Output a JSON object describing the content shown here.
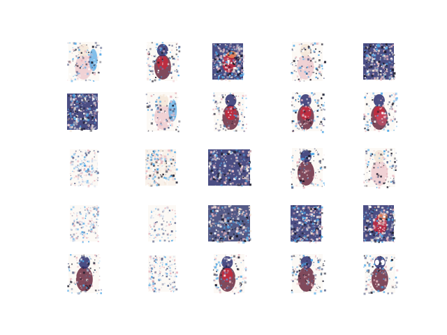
{
  "figure": {
    "rows": 5,
    "cols": 5,
    "background": "#ffffff",
    "palette": {
      "navy": "#2b2f6e",
      "maroon": "#6a2a3f",
      "crimson": "#c8283c",
      "pink": "#e8b7c0",
      "sky": "#4fa7e6",
      "cream": "#f3e6d7",
      "slate": "#5a6288",
      "ink": "#1a1a2a"
    },
    "tiles": [
      {
        "id": 1,
        "motif": "figure-left-blue-right"
      },
      {
        "id": 2,
        "motif": "red-figure-thin"
      },
      {
        "id": 3,
        "motif": "dark-block-red-center"
      },
      {
        "id": 4,
        "motif": "pale-figure"
      },
      {
        "id": 5,
        "motif": "dark-noisy-block"
      },
      {
        "id": 6,
        "motif": "dark-noisy-block"
      },
      {
        "id": 7,
        "motif": "faint-figure-blue-spots"
      },
      {
        "id": 8,
        "motif": "red-figure-crouched"
      },
      {
        "id": 9,
        "motif": "blurred-face"
      },
      {
        "id": 10,
        "motif": "blurred-face-pink"
      },
      {
        "id": 11,
        "motif": "blue-edge-noisy-dark-foot"
      },
      {
        "id": 12,
        "motif": "noisy-block-faint"
      },
      {
        "id": 13,
        "motif": "wide-noisy-block"
      },
      {
        "id": 14,
        "motif": "angled-dark-figure"
      },
      {
        "id": 15,
        "motif": "grey-figure"
      },
      {
        "id": 16,
        "motif": "faint-pattern"
      },
      {
        "id": 17,
        "motif": "very-faint"
      },
      {
        "id": 18,
        "motif": "wide-noisy-block-purple"
      },
      {
        "id": 19,
        "motif": "noisy-block-dark"
      },
      {
        "id": 20,
        "motif": "dark-block-red-orange"
      },
      {
        "id": 21,
        "motif": "dark-figure-head"
      },
      {
        "id": 22,
        "motif": "faint-noisy-column"
      },
      {
        "id": 23,
        "motif": "figure-with-red-center"
      },
      {
        "id": 24,
        "motif": "thin-dark-figure"
      },
      {
        "id": 25,
        "motif": "dark-figure-white-eyes"
      }
    ]
  }
}
